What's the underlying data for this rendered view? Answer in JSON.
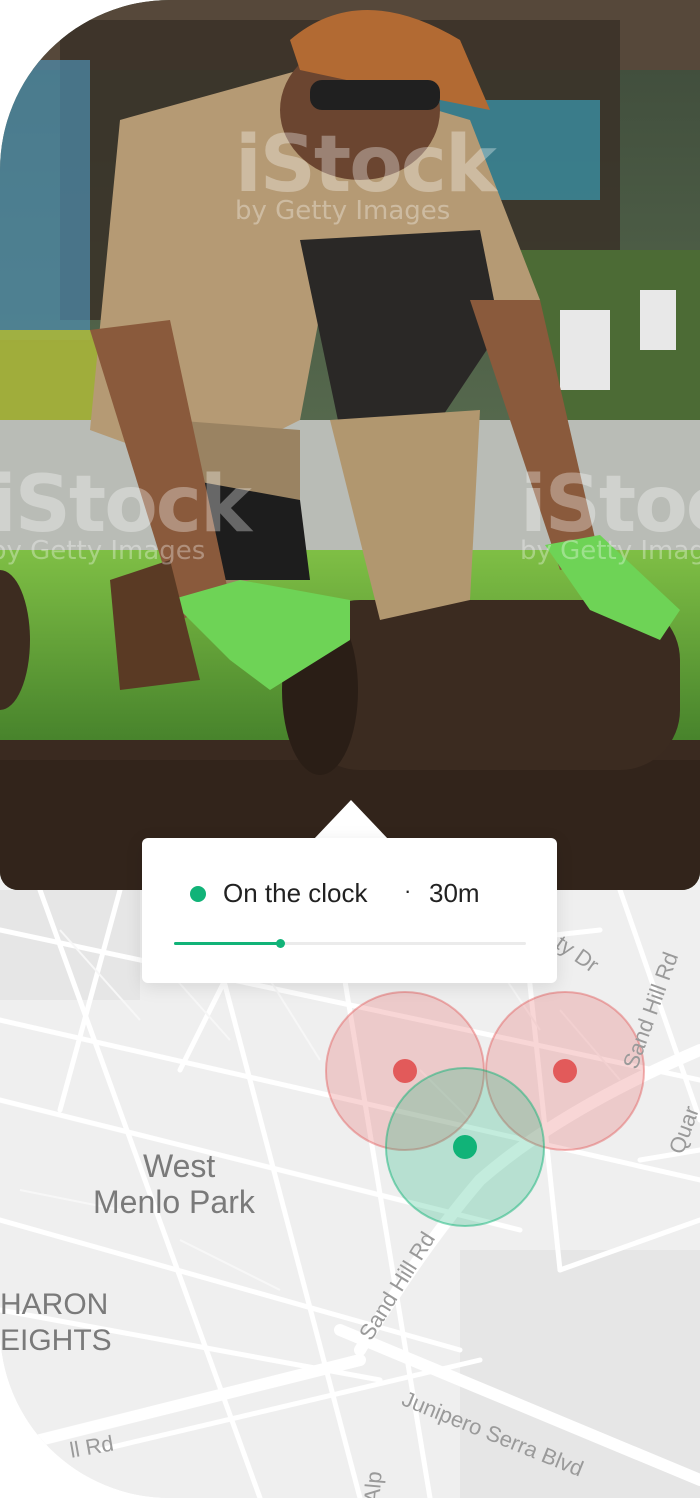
{
  "photo": {
    "watermark_brand": "iStock",
    "watermark_sub": "by Getty Images"
  },
  "status": {
    "label": "On the clock",
    "separator": "·",
    "duration": "30m",
    "progress": 0.3,
    "color": "#11b378"
  },
  "map": {
    "places": [
      "West",
      "Menlo Park",
      "HARON",
      "EIGHTS"
    ],
    "roads": [
      "ty Dr",
      "Sand Hill Rd",
      "Sand Hill Rd",
      "Quar",
      "Junipero Serra Blvd",
      "ll Rd",
      "Alp"
    ],
    "geofence_colors": {
      "outside": "#e25a5a",
      "inside": "#11b378"
    }
  }
}
